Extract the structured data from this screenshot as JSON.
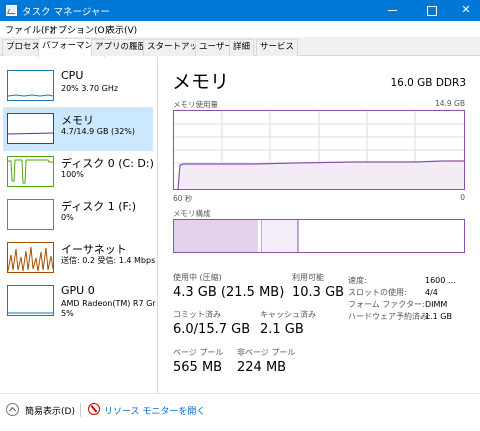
{
  "window": {
    "title": "タスク マネージャー",
    "minimize": "",
    "maximize": "",
    "close": "✕"
  },
  "menu": [
    "ファイル(F)",
    "オプション(O)",
    "表示(V)"
  ],
  "tabs": [
    {
      "label": "プロセス",
      "active": false
    },
    {
      "label": "パフォーマンス",
      "active": true
    },
    {
      "label": "アプリの履歴",
      "active": false
    },
    {
      "label": "スタートアップ",
      "active": false
    },
    {
      "label": "ユーザー",
      "active": false
    },
    {
      "label": "詳細",
      "active": false
    },
    {
      "label": "サービス",
      "active": false
    }
  ],
  "resources": [
    {
      "name": "CPU",
      "line1": "20% 3.70 GHz",
      "line2": "",
      "color": "#117dbb"
    },
    {
      "name": "メモリ",
      "line1": "4.7/14.9 GB (32%)",
      "line2": "",
      "color": "#8b12ae"
    },
    {
      "name": "ディスク 0 (C: D:)",
      "line1": "100%",
      "line2": "",
      "color": "#4da60c"
    },
    {
      "name": "ディスク 1 (F:)",
      "line1": "0%",
      "line2": "",
      "color": "#4da60c"
    },
    {
      "name": "イーサネット",
      "line1": "送信: 0.2 受信: 1.4 Mbps",
      "line2": "",
      "color": "#a74f01"
    },
    {
      "name": "GPU 0",
      "line1": "AMD Radeon(TM) R7 Gr",
      "line2": "5%",
      "color": "#117dbb"
    }
  ],
  "memory": {
    "title": "メモリ",
    "spec": "16.0 GB DDR3",
    "usage_label": "メモリ使用量",
    "usage_max": "14.9 GB",
    "axis_left": "60 秒",
    "axis_right": "0",
    "composition_label": "メモリ構成",
    "stats": {
      "in_use_label": "使用中 (圧縮)",
      "in_use_value": "4.3 GB (21.5 MB)",
      "available_label": "利用可能",
      "available_value": "10.3 GB",
      "committed_label": "コミット済み",
      "committed_value": "6.0/15.7 GB",
      "cached_label": "キャッシュ済み",
      "cached_value": "2.1 GB",
      "paged_label": "ページ プール",
      "paged_value": "565 MB",
      "nonpaged_label": "非ページ プール",
      "nonpaged_value": "224 MB"
    },
    "details": [
      {
        "k": "速度:",
        "v": "1600 ..."
      },
      {
        "k": "スロットの使用:",
        "v": "4/4"
      },
      {
        "k": "フォーム ファクター:",
        "v": "DIMM"
      },
      {
        "k": "ハードウェア予約済み:",
        "v": "1.1 GB"
      }
    ]
  },
  "footer": {
    "fewer_details": "簡易表示(D)",
    "resource_monitor": "リソース モニターを開く"
  },
  "colors": {
    "accent": "#0078d7",
    "memory_line": "#8b4fb0",
    "selected_bg": "#cce8ff"
  }
}
